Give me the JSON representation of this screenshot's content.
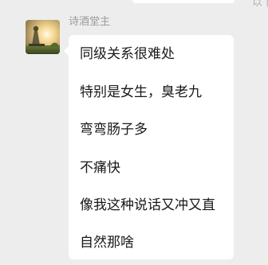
{
  "chat": {
    "top_right_text": "以下",
    "sender_name": "诗酒堂主",
    "avatar_icon": "statue-avatar-icon",
    "message_lines": [
      "同级关系很难处",
      "特别是女生，臭老九",
      "弯弯肠子多",
      "不痛快",
      "像我这种说话又冲又直",
      "自然那啥"
    ]
  },
  "colors": {
    "background": "#ededed",
    "bubble": "#ffffff",
    "text": "#191919",
    "name": "#9b9b9b"
  }
}
